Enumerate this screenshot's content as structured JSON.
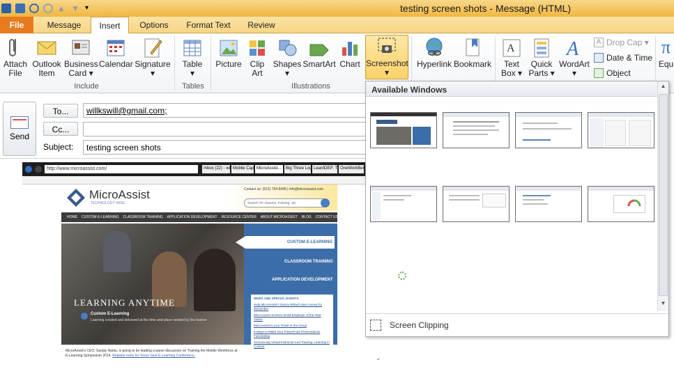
{
  "window": {
    "title": "testing screen shots  -  Message (HTML)"
  },
  "tabs": [
    {
      "label": "File"
    },
    {
      "label": "Message"
    },
    {
      "label": "Insert"
    },
    {
      "label": "Options"
    },
    {
      "label": "Format Text"
    },
    {
      "label": "Review"
    }
  ],
  "ribbon": {
    "include": {
      "group_label": "Include",
      "attach_file": "Attach\nFile",
      "outlook_item": "Outlook\nItem",
      "business_card": "Business\nCard ▾",
      "calendar": "Calendar",
      "signature": "Signature\n▾"
    },
    "tables": {
      "group_label": "Tables",
      "table": "Table\n▾"
    },
    "illustrations": {
      "group_label": "Illustrations",
      "picture": "Picture",
      "clip_art": "Clip\nArt",
      "shapes": "Shapes\n▾",
      "smartart": "SmartArt",
      "chart": "Chart",
      "screenshot": "Screenshot\n▾"
    },
    "links": {
      "hyperlink": "Hyperlink",
      "bookmark": "Bookmark"
    },
    "text": {
      "text_box": "Text\nBox ▾",
      "quick_parts": "Quick\nParts ▾",
      "wordart": "WordArt\n▾",
      "drop_cap": "Drop Cap ▾",
      "date_time": "Date & Time",
      "object": "Object"
    },
    "symbols": {
      "equation": "Equ"
    }
  },
  "compose": {
    "send": "Send",
    "to_button": "To...",
    "cc_button": "Cc...",
    "subject_label": "Subject:",
    "to_value": "willkswill@gmail.com;",
    "cc_value": "",
    "subject_value": "testing screen shots"
  },
  "screenshot_panel": {
    "title": "Available Windows",
    "screen_clipping": "Screen Clipping",
    "thumbnails": 8
  },
  "embedded_screenshot": {
    "address": "http://www.microassist.com/",
    "browser_tabs": [
      "Inbox (22) - willk...",
      "Mobile Captivat...",
      "MicroAssist...",
      "Big Three Logos...",
      "LeanIDEP: Typi...",
      "OneWorkBench..."
    ],
    "brand": "MicroAssist",
    "brand_sub": "TECHNOLOGY WISE",
    "contact": "Contact us: (512) 794-8440 | info@microassist.com",
    "search_placeholder": "Search for classes, training, etc",
    "nav": [
      "HOME",
      "CUSTOM E-LEARNING",
      "CLASSROOM TRAINING",
      "APPLICATION DEVELOPMENT",
      "RESOURCE CENTER",
      "ABOUT MICROASSIST",
      "BLOG",
      "CONTACT US"
    ],
    "side_links": [
      "CUSTOM E-LEARNING",
      "CLASSROOM TRAINING",
      "APPLICATION DEVELOPMENT"
    ],
    "hero_text": "LEARNING ANYTIME",
    "hero_sub_title": "Custom E-Learning",
    "hero_sub_text": "Learning created and delivered at the time and place needed by the learner",
    "news_title": "NEWS AND SPECIAL EVENTS",
    "news": [
      "Help MicroAssist's Danny Willard raise money for Movember",
      "MicroAssist receives Small Employer of the Year Award",
      "MicroAssist is your Ticket to the Cloud",
      "5 Ways to Make Your PowerPoint Presentations Fascinating",
      "Announcing Virtual Instructor-Led Training: Learning in Context"
    ],
    "footer_text": "MicroAssist's CEO, Sanjay Naidu, is going to be leading a panel discussion on Training the Mobile Workforce at E-Learning Symposium 2014.",
    "footer_link": "Register early for Texas' best E-Learning Conference."
  }
}
